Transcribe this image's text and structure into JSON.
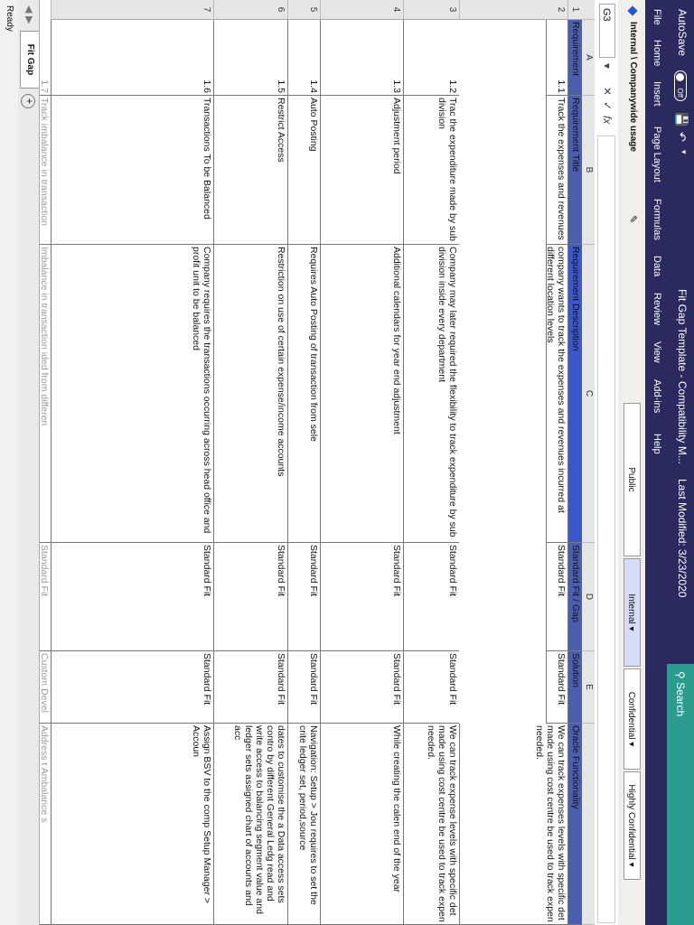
{
  "titlebar": {
    "autosave": "AutoSave",
    "autosave_state": "Off",
    "title": "Fit Gap Template - Compatibility M...",
    "modified": "Last Modified: 3/23/2020",
    "search": "Search"
  },
  "ribbon": {
    "tabs": [
      "File",
      "Home",
      "Insert",
      "Page Layout",
      "Formulas",
      "Data",
      "Review",
      "View",
      "Add-ins",
      "Help"
    ]
  },
  "sensitivity": {
    "label": "Internal \\ Companywide usage",
    "buttons": [
      "Public",
      "Internal",
      "Confidential",
      "Highly Confidential"
    ]
  },
  "formula_bar": {
    "name_box": "G3",
    "cancel": "✕",
    "enter": "✓",
    "fx": "fx",
    "value": ""
  },
  "grid": {
    "col_headers": [
      "A",
      "B",
      "C",
      "D",
      "E"
    ],
    "row_headers": [
      "1",
      "2",
      "3",
      "4",
      "5",
      "6",
      "7"
    ],
    "header_row": [
      "Requirement",
      "Requirement Title",
      "Requirement Description",
      "Standard Fit / Gap",
      "Solution Approach",
      "Oracle Functionality"
    ],
    "rows": [
      {
        "id": "1.1",
        "title": "Track the expenses and revenues",
        "description": "company wants to track the expenses and revenues incurred at different location levels",
        "fit": "Standard Fit",
        "approach": "Standard Fit",
        "oracle": "We can track expenses levels with specific det made using cost centre be used to track expen needed."
      },
      {
        "id": "1.2",
        "title": "Trac the expenditure made by sub division",
        "description": "Company may later required the flexibility to track expenditure by sub division inside every department",
        "fit": "Standard Fit",
        "approach": "Standard Fit",
        "oracle": "We can track expense levels with specific det made using cost centre be used to track expen needed."
      },
      {
        "id": "1.3",
        "title": "Adjustment period",
        "description": "Additional calendars for year end adjustment",
        "fit": "Standard Fit",
        "approach": "Standard Fit",
        "oracle": "While creating the calen end of the year"
      },
      {
        "id": "1.4",
        "title": "Auto Posting",
        "description": "Requires Auto Posting of transaction from sele",
        "fit": "Standard Fit",
        "approach": "Standard Fit",
        "oracle": "Navigation: Setup > Jou requires to set the crite ledger set, period,source"
      },
      {
        "id": "1.5",
        "title": "Restrict Access",
        "description": "Restriction on use of certain expense/income accounts",
        "fit": "Standard Fit",
        "approach": "Standard Fit",
        "oracle": "dates to customise the a Data access sets contro by different General Ledg read and write access to balancing segment value and ledger sets assigned chart of accounts and acc"
      },
      {
        "id": "1.6",
        "title": "Transactions To be Balanced",
        "description": "Company requires the transactions occurring across head office and profit unit to be balanced",
        "fit": "Standard Fit",
        "approach": "Standard Fit",
        "oracle": "Assign BSV to the comp Setup Manager > Accoun"
      },
      {
        "id": "1.7",
        "title": "Track imbalance in transaction",
        "description": "Imbalance in transaction ided from differen",
        "fit": "Standard Fit",
        "approach": "Custom Devel Dnoeb",
        "oracle": "Address t Ambalance s"
      }
    ]
  },
  "sheet_tabs": {
    "active": "Fit Gap Analysis",
    "add": "+"
  },
  "status": {
    "text": "Ready"
  },
  "colors": {
    "title_bg": "#2b2a5f",
    "search_bg": "#2a9d8f",
    "header_fill": "#4b5fb0"
  }
}
